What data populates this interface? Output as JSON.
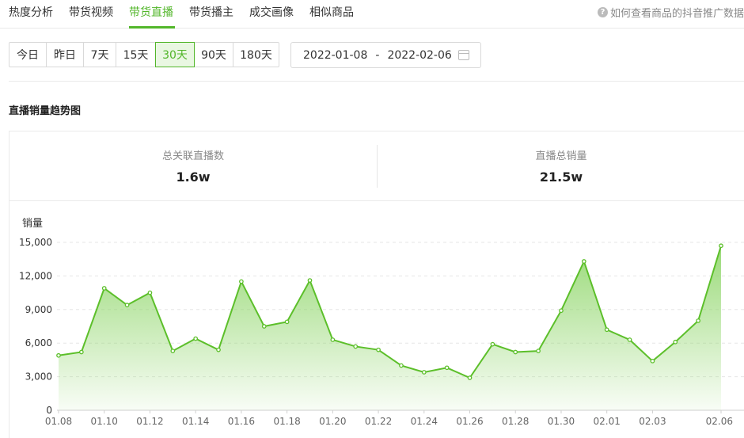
{
  "tabs": [
    {
      "label": "热度分析",
      "active": false
    },
    {
      "label": "带货视频",
      "active": false
    },
    {
      "label": "带货直播",
      "active": true
    },
    {
      "label": "带货播主",
      "active": false
    },
    {
      "label": "成交画像",
      "active": false
    },
    {
      "label": "相似商品",
      "active": false
    }
  ],
  "help_text": "如何查看商品的抖音推广数据",
  "range_buttons": [
    {
      "label": "今日",
      "active": false
    },
    {
      "label": "昨日",
      "active": false
    },
    {
      "label": "7天",
      "active": false
    },
    {
      "label": "15天",
      "active": false
    },
    {
      "label": "30天",
      "active": true
    },
    {
      "label": "90天",
      "active": false
    },
    {
      "label": "180天",
      "active": false
    }
  ],
  "date_range": {
    "start": "2022-01-08",
    "separator": "-",
    "end": "2022-02-06"
  },
  "section_title": "直播销量趋势图",
  "stats": [
    {
      "label": "总关联直播数",
      "value": "1.6w"
    },
    {
      "label": "直播总销量",
      "value": "21.5w"
    }
  ],
  "colors": {
    "accent": "#52b62a",
    "line": "#5cbf2a",
    "area_top": "#8fd66a"
  },
  "chart_data": {
    "type": "area",
    "ylabel": "销量",
    "ylim": [
      0,
      15000
    ],
    "yticks": [
      0,
      3000,
      6000,
      9000,
      12000,
      15000
    ],
    "ytick_labels": [
      "0",
      "3,000",
      "6,000",
      "9,000",
      "12,000",
      "15,000"
    ],
    "x": [
      "01.08",
      "01.09",
      "01.10",
      "01.11",
      "01.12",
      "01.13",
      "01.14",
      "01.15",
      "01.16",
      "01.17",
      "01.18",
      "01.19",
      "01.20",
      "01.21",
      "01.22",
      "01.23",
      "01.24",
      "01.25",
      "01.26",
      "01.27",
      "01.28",
      "01.29",
      "01.30",
      "01.31",
      "02.01",
      "02.02",
      "02.03",
      "02.04",
      "02.05",
      "02.06"
    ],
    "xtick_labels": [
      "01.08",
      "01.10",
      "01.12",
      "01.14",
      "01.16",
      "01.18",
      "01.20",
      "01.22",
      "01.24",
      "01.26",
      "01.28",
      "01.30",
      "02.01",
      "02.03",
      "02.06"
    ],
    "values": [
      4900,
      5200,
      10900,
      9400,
      10500,
      5300,
      6400,
      5400,
      11500,
      7500,
      7900,
      11600,
      6300,
      5700,
      5400,
      4000,
      3400,
      3800,
      2900,
      5900,
      5200,
      5300,
      8900,
      13300,
      7200,
      6300,
      4400,
      6100,
      8000,
      14700
    ]
  }
}
